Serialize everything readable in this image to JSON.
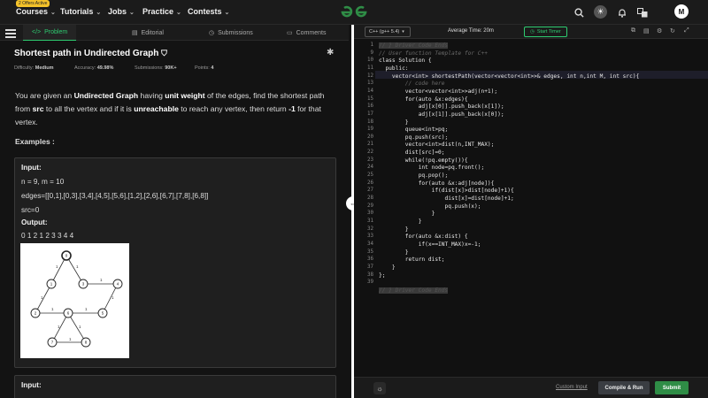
{
  "nav": {
    "offers_badge": "2 Offers Active",
    "items": [
      {
        "label": "Courses"
      },
      {
        "label": "Tutorials"
      },
      {
        "label": "Jobs"
      },
      {
        "label": "Practice"
      },
      {
        "label": "Contests"
      }
    ],
    "logo_text": "GfG",
    "avatar": "M",
    "brand_color": "#2f8d46"
  },
  "left_tabs": [
    {
      "label": "Problem",
      "icon": "code-icon"
    },
    {
      "label": "Editorial",
      "icon": "document-icon"
    },
    {
      "label": "Submissions",
      "icon": "clock-icon"
    },
    {
      "label": "Comments",
      "icon": "comment-icon"
    }
  ],
  "problem": {
    "title": "Shortest path in Undirected Graph",
    "difficulty_label": "Difficulty:",
    "difficulty": "Medium",
    "accuracy_label": "Accuracy:",
    "accuracy": "49.98%",
    "submissions_label": "Submissions:",
    "submissions": "90K+",
    "points_label": "Points:",
    "points": "4",
    "desc": {
      "t1": "You are given an ",
      "b1": "Undirected Graph",
      "t2": " having ",
      "b2": "unit weight",
      "t3": " of the edges, find the shortest path from ",
      "b3": "src",
      "t4": " to all the vertex and if it is ",
      "b4": "unreachable",
      "t5": " to reach any vertex, then return ",
      "b5": "-1",
      "t6": " for that vertex."
    },
    "examples_label": "Examples :",
    "example": {
      "input_label": "Input:",
      "line1": "n = 9, m = 10",
      "line2": "edges=[[0,1],[0,3],[3,4],[4,5],[5,6],[1,2],[2,6],[6,7],[7,8],[6,8]]",
      "line3": "src=0",
      "output_label": "Output:",
      "output": "0 1 2 1 2 3 3 4 4"
    },
    "example2_input_label": "Input:"
  },
  "editor": {
    "language": "C++ (g++ 5.4)",
    "avg_time": "Average Time: 20m",
    "start_timer": "Start Timer",
    "lines": [
      "// } Driver Code Ends",
      "// User function Template for C++",
      "class Solution {",
      "  public:",
      "    vector<int> shortestPath(vector<vector<int>>& edges, int n,int M, int src){",
      "        // code here",
      "        vector<vector<int>>adj(n+1);",
      "        for(auto &x:edges){",
      "            adj[x[0]].push_back(x[1]);",
      "            adj[x[1]].push_back(x[0]);",
      "        }",
      "        queue<int>pq;",
      "        pq.push(src);",
      "        vector<int>dist(n,INT_MAX);",
      "        dist[src]=0;",
      "        while(!pq.empty()){",
      "            int node=pq.front();",
      "            pq.pop();",
      "            for(auto &x:adj[node]){",
      "                if(dist[x]>dist[node]+1){",
      "                    dist[x]=dist[node]+1;",
      "                    pq.push(x);",
      "                }",
      "            }",
      "        }",
      "        for(auto &x:dist) {",
      "            if(x==INT_MAX)x=-1;",
      "        }",
      "        return dist;",
      "    }",
      "};",
      "",
      "// } Driver Code Ends"
    ],
    "line_numbers": [
      "1",
      "9",
      "10",
      "11",
      "12",
      "13",
      "14",
      "15",
      "16",
      "17",
      "18",
      "19",
      "20",
      "21",
      "22",
      "23",
      "24",
      "25",
      "26",
      "27",
      "28",
      "29",
      "30",
      "31",
      "32",
      "33",
      "34",
      "35",
      "36",
      "37",
      "38",
      "39"
    ],
    "custom_input": "Custom Input",
    "compile_run": "Compile & Run",
    "submit": "Submit"
  },
  "graph": {
    "nodes": [
      "0",
      "1",
      "2",
      "3",
      "4",
      "5",
      "6",
      "7",
      "8"
    ],
    "edge_labels": [
      "1",
      "1",
      "1",
      "1",
      "1",
      "1",
      "1",
      "1",
      "1",
      "1"
    ]
  }
}
